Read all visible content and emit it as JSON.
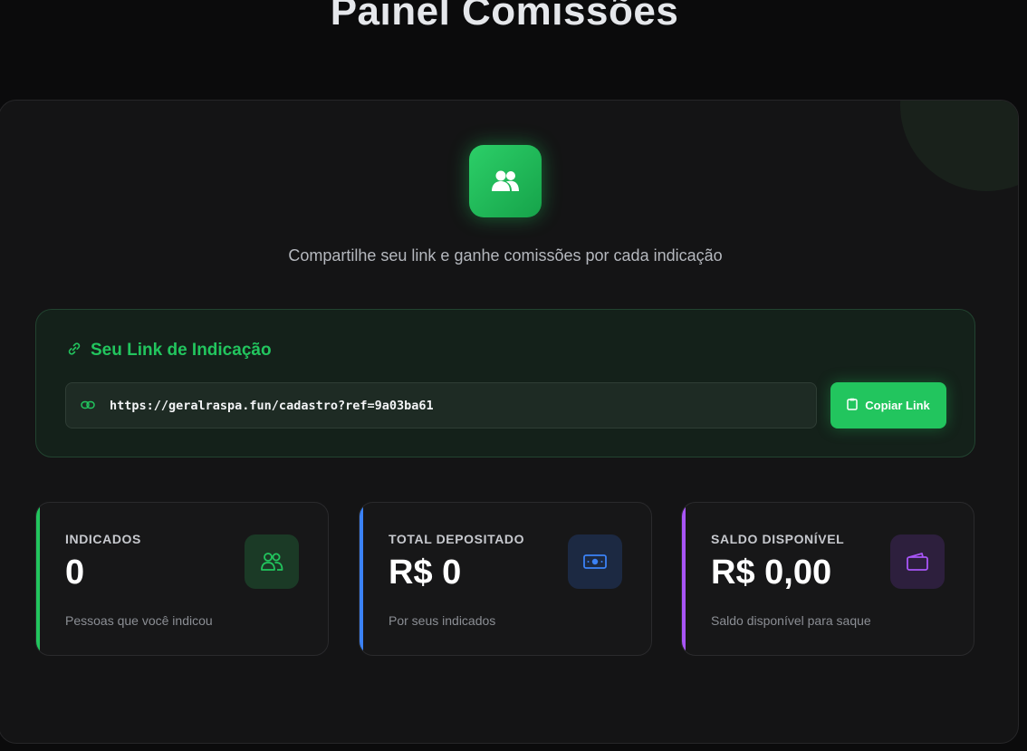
{
  "page": {
    "title": "Painel Comissões"
  },
  "hero": {
    "icon": "users-icon",
    "subtitle": "Compartilhe seu link e ganhe comissões por cada indicação"
  },
  "referral": {
    "title": "Seu Link de Indicação",
    "title_icon": "link-icon",
    "field_icon": "chain-link-icon",
    "url": "https://geralraspa.fun/cadastro?ref=9a03ba61",
    "copy_button": {
      "label": "Copiar Link",
      "icon": "clipboard-icon"
    }
  },
  "stats": [
    {
      "label": "INDICADOS",
      "value": "0",
      "description": "Pessoas que você indicou",
      "icon": "users-icon",
      "accent": "#22c55e"
    },
    {
      "label": "TOTAL DEPOSITADO",
      "value": "R$ 0",
      "description": "Por seus indicados",
      "icon": "banknote-icon",
      "accent": "#3b82f6"
    },
    {
      "label": "SALDO DISPONÍVEL",
      "value": "R$ 0,00",
      "description": "Saldo disponível para saque",
      "icon": "wallet-icon",
      "accent": "#a855f7"
    }
  ],
  "colors": {
    "brand_green": "#22c55e",
    "blue": "#3b82f6",
    "purple": "#a855f7",
    "background": "#0b0b0c"
  }
}
